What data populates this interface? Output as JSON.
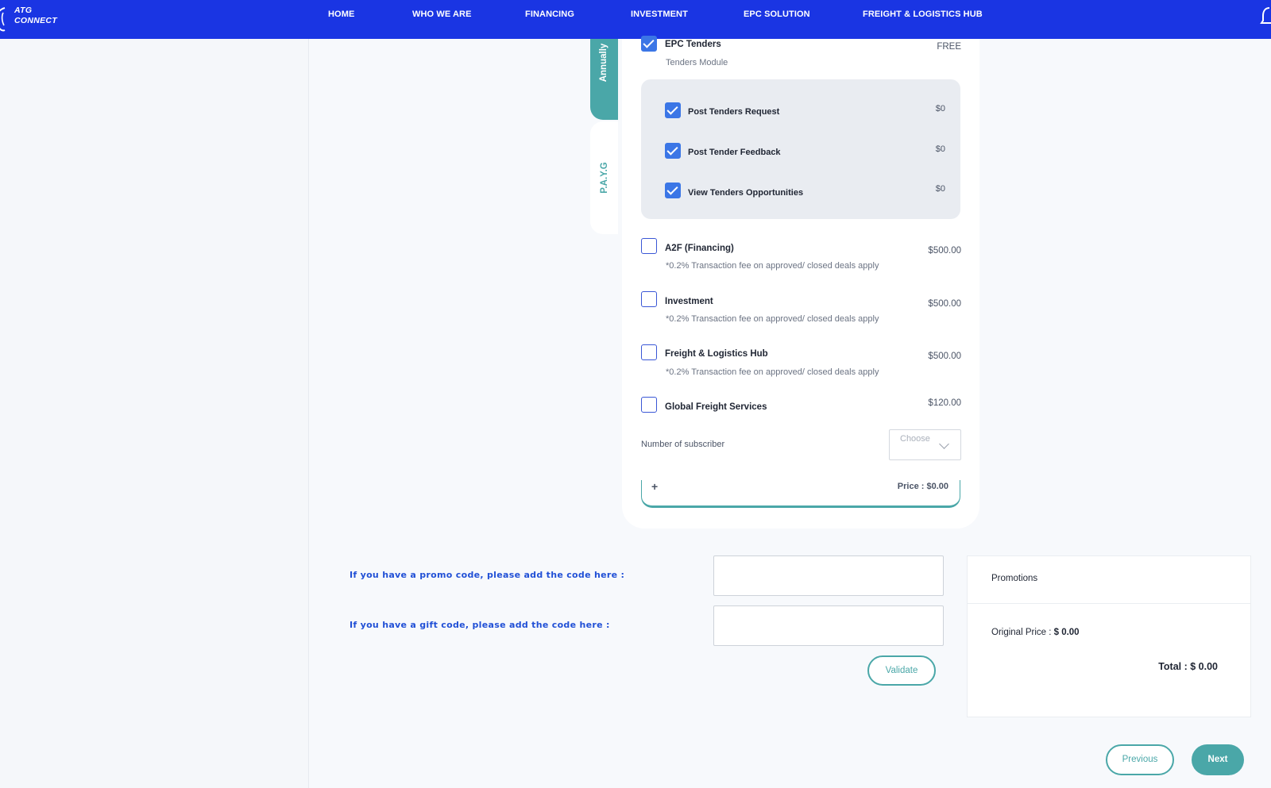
{
  "nav": {
    "logo_line1": "ATG",
    "logo_line2": "CONNECT",
    "links": [
      "HOME",
      "WHO WE ARE",
      "FINANCING",
      "INVESTMENT",
      "EPC SOLUTION",
      "FREIGHT & LOGISTICS HUB"
    ]
  },
  "tabs": {
    "annually": "Annually",
    "payg": "P.A.Y.G"
  },
  "plan": {
    "epc": {
      "title": "EPC Tenders",
      "subtitle": "Tenders Module",
      "price": "FREE",
      "checked": true
    },
    "epc_items": [
      {
        "title": "Post Tenders Request",
        "price": "$0",
        "checked": true
      },
      {
        "title": "Post Tender Feedback",
        "price": "$0",
        "checked": true
      },
      {
        "title": "View Tenders Opportunities",
        "price": "$0",
        "checked": true
      }
    ],
    "modules": [
      {
        "title": "A2F (Financing)",
        "subtitle": "*0.2% Transaction fee on approved/ closed deals apply",
        "price": "$500.00",
        "checked": false
      },
      {
        "title": "Investment",
        "subtitle": "*0.2% Transaction fee on approved/ closed deals apply",
        "price": "$500.00",
        "checked": false
      },
      {
        "title": "Freight & Logistics Hub",
        "subtitle": "*0.2% Transaction fee on approved/ closed deals apply",
        "price": "$500.00",
        "checked": false
      },
      {
        "title": "Global Freight Services",
        "subtitle": "",
        "price": "$120.00",
        "checked": false
      }
    ],
    "subscriber_label": "Number of subscriber",
    "subscriber_placeholder": "Choose",
    "plus": "+",
    "price_total": "Price : $0.00"
  },
  "codes": {
    "promo_label": "If you have a promo code, please add the code here :",
    "gift_label": "If you have a gift code, please add the code here :",
    "validate": "Validate"
  },
  "promotions": {
    "title": "Promotions",
    "original_label": "Original Price : ",
    "original_value": "$ 0.00",
    "total_label": "Total : ",
    "total_value": "$ 0.00"
  },
  "footer": {
    "previous": "Previous",
    "next": "Next"
  },
  "colors": {
    "nav": "#1a35e3",
    "accent": "#4aa7a8",
    "checkbox": "#3b76e6",
    "promo_text": "#2150d6"
  }
}
